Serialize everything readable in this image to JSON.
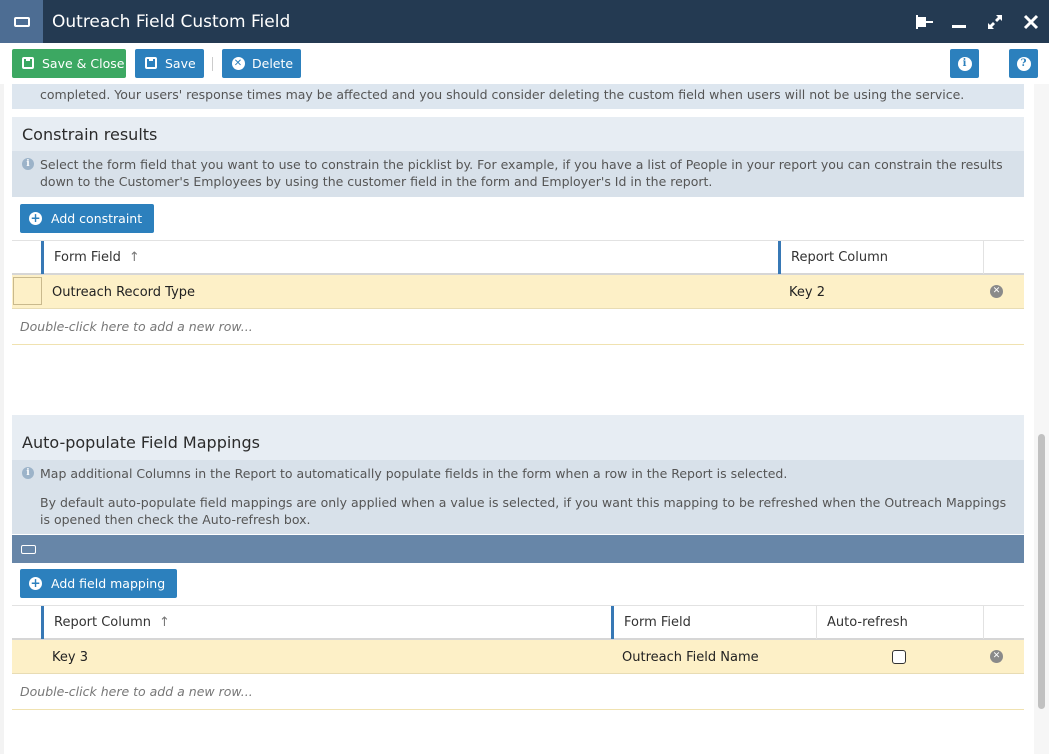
{
  "window": {
    "title": "Outreach Field Custom Field"
  },
  "toolbar": {
    "save_close_label": "Save & Close",
    "save_label": "Save",
    "delete_label": "Delete"
  },
  "top_notice": "completed. Your users' response times may be affected and you should consider deleting the custom field when users will not be using the service.",
  "constrain": {
    "title": "Constrain results",
    "info": "Select the form field that you want to use to constrain the picklist by. For example, if you have a list of People in your report you can constrain the results down to the Customer's Employees by using the customer field in the form and Employer's Id in the report.",
    "add_label": "Add constraint",
    "columns": [
      "Form Field",
      "Report Column"
    ],
    "rows": [
      {
        "form_field": "Outreach Record Type",
        "report_column": "Key 2"
      }
    ],
    "new_row_hint": "Double-click here to add a new row..."
  },
  "mappings": {
    "title": "Auto-populate Field Mappings",
    "info_1": "Map additional Columns in the Report to automatically populate fields in the form when a row in the Report is selected.",
    "info_2": "By default auto-populate field mappings are only applied when a value is selected, if you want this mapping to be refreshed when the Outreach Mappings is opened then check the Auto-refresh box.",
    "add_label": "Add field mapping",
    "columns": [
      "Report Column",
      "Form Field",
      "Auto-refresh"
    ],
    "rows": [
      {
        "report_column": "Key 3",
        "form_field": "Outreach Field Name",
        "auto_refresh": false
      }
    ],
    "new_row_hint": "Double-click here to add a new row..."
  },
  "colors": {
    "titlebar": "#243a52",
    "save_close": "#3ca862",
    "primary": "#2c80bd",
    "selected_row": "#fdf0c7"
  }
}
